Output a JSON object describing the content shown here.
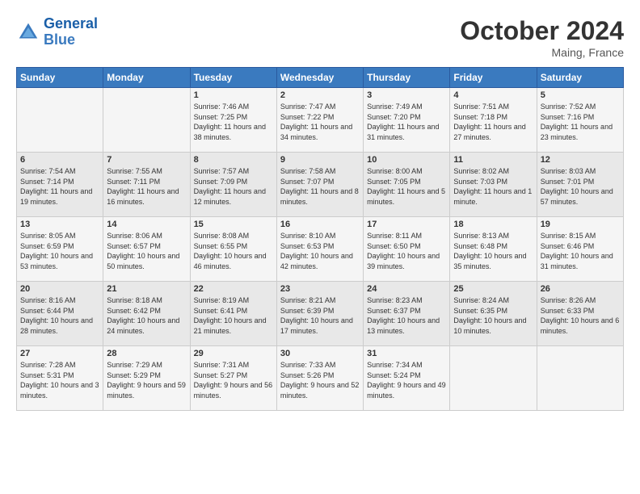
{
  "header": {
    "logo_line1": "General",
    "logo_line2": "Blue",
    "month": "October 2024",
    "location": "Maing, France"
  },
  "weekdays": [
    "Sunday",
    "Monday",
    "Tuesday",
    "Wednesday",
    "Thursday",
    "Friday",
    "Saturday"
  ],
  "weeks": [
    [
      {
        "day": "",
        "info": ""
      },
      {
        "day": "",
        "info": ""
      },
      {
        "day": "1",
        "info": "Sunrise: 7:46 AM\nSunset: 7:25 PM\nDaylight: 11 hours and 38 minutes."
      },
      {
        "day": "2",
        "info": "Sunrise: 7:47 AM\nSunset: 7:22 PM\nDaylight: 11 hours and 34 minutes."
      },
      {
        "day": "3",
        "info": "Sunrise: 7:49 AM\nSunset: 7:20 PM\nDaylight: 11 hours and 31 minutes."
      },
      {
        "day": "4",
        "info": "Sunrise: 7:51 AM\nSunset: 7:18 PM\nDaylight: 11 hours and 27 minutes."
      },
      {
        "day": "5",
        "info": "Sunrise: 7:52 AM\nSunset: 7:16 PM\nDaylight: 11 hours and 23 minutes."
      }
    ],
    [
      {
        "day": "6",
        "info": "Sunrise: 7:54 AM\nSunset: 7:14 PM\nDaylight: 11 hours and 19 minutes."
      },
      {
        "day": "7",
        "info": "Sunrise: 7:55 AM\nSunset: 7:11 PM\nDaylight: 11 hours and 16 minutes."
      },
      {
        "day": "8",
        "info": "Sunrise: 7:57 AM\nSunset: 7:09 PM\nDaylight: 11 hours and 12 minutes."
      },
      {
        "day": "9",
        "info": "Sunrise: 7:58 AM\nSunset: 7:07 PM\nDaylight: 11 hours and 8 minutes."
      },
      {
        "day": "10",
        "info": "Sunrise: 8:00 AM\nSunset: 7:05 PM\nDaylight: 11 hours and 5 minutes."
      },
      {
        "day": "11",
        "info": "Sunrise: 8:02 AM\nSunset: 7:03 PM\nDaylight: 11 hours and 1 minute."
      },
      {
        "day": "12",
        "info": "Sunrise: 8:03 AM\nSunset: 7:01 PM\nDaylight: 10 hours and 57 minutes."
      }
    ],
    [
      {
        "day": "13",
        "info": "Sunrise: 8:05 AM\nSunset: 6:59 PM\nDaylight: 10 hours and 53 minutes."
      },
      {
        "day": "14",
        "info": "Sunrise: 8:06 AM\nSunset: 6:57 PM\nDaylight: 10 hours and 50 minutes."
      },
      {
        "day": "15",
        "info": "Sunrise: 8:08 AM\nSunset: 6:55 PM\nDaylight: 10 hours and 46 minutes."
      },
      {
        "day": "16",
        "info": "Sunrise: 8:10 AM\nSunset: 6:53 PM\nDaylight: 10 hours and 42 minutes."
      },
      {
        "day": "17",
        "info": "Sunrise: 8:11 AM\nSunset: 6:50 PM\nDaylight: 10 hours and 39 minutes."
      },
      {
        "day": "18",
        "info": "Sunrise: 8:13 AM\nSunset: 6:48 PM\nDaylight: 10 hours and 35 minutes."
      },
      {
        "day": "19",
        "info": "Sunrise: 8:15 AM\nSunset: 6:46 PM\nDaylight: 10 hours and 31 minutes."
      }
    ],
    [
      {
        "day": "20",
        "info": "Sunrise: 8:16 AM\nSunset: 6:44 PM\nDaylight: 10 hours and 28 minutes."
      },
      {
        "day": "21",
        "info": "Sunrise: 8:18 AM\nSunset: 6:42 PM\nDaylight: 10 hours and 24 minutes."
      },
      {
        "day": "22",
        "info": "Sunrise: 8:19 AM\nSunset: 6:41 PM\nDaylight: 10 hours and 21 minutes."
      },
      {
        "day": "23",
        "info": "Sunrise: 8:21 AM\nSunset: 6:39 PM\nDaylight: 10 hours and 17 minutes."
      },
      {
        "day": "24",
        "info": "Sunrise: 8:23 AM\nSunset: 6:37 PM\nDaylight: 10 hours and 13 minutes."
      },
      {
        "day": "25",
        "info": "Sunrise: 8:24 AM\nSunset: 6:35 PM\nDaylight: 10 hours and 10 minutes."
      },
      {
        "day": "26",
        "info": "Sunrise: 8:26 AM\nSunset: 6:33 PM\nDaylight: 10 hours and 6 minutes."
      }
    ],
    [
      {
        "day": "27",
        "info": "Sunrise: 7:28 AM\nSunset: 5:31 PM\nDaylight: 10 hours and 3 minutes."
      },
      {
        "day": "28",
        "info": "Sunrise: 7:29 AM\nSunset: 5:29 PM\nDaylight: 9 hours and 59 minutes."
      },
      {
        "day": "29",
        "info": "Sunrise: 7:31 AM\nSunset: 5:27 PM\nDaylight: 9 hours and 56 minutes."
      },
      {
        "day": "30",
        "info": "Sunrise: 7:33 AM\nSunset: 5:26 PM\nDaylight: 9 hours and 52 minutes."
      },
      {
        "day": "31",
        "info": "Sunrise: 7:34 AM\nSunset: 5:24 PM\nDaylight: 9 hours and 49 minutes."
      },
      {
        "day": "",
        "info": ""
      },
      {
        "day": "",
        "info": ""
      }
    ]
  ]
}
